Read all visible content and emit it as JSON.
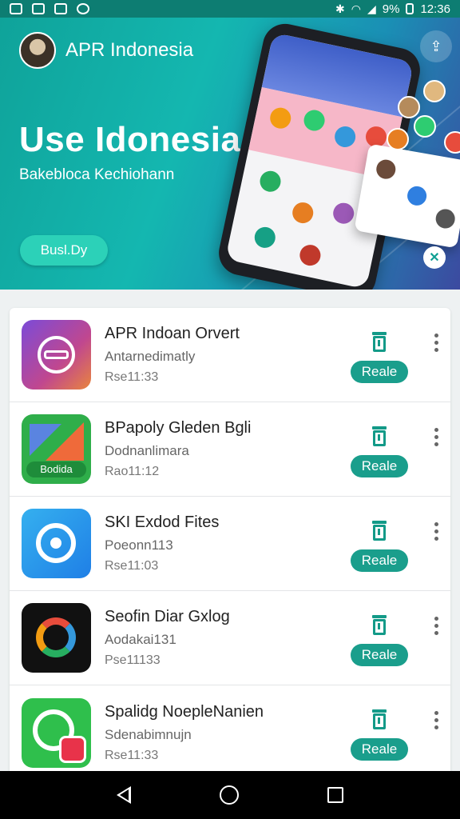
{
  "status_bar": {
    "time": "12:36",
    "battery": "9%"
  },
  "hero": {
    "brand_name": "APR Indonesia",
    "title": "Use Idonesia",
    "subtitle": "Bakebloca Kechiohann",
    "cta_label": "Busl.Dy"
  },
  "apps": [
    {
      "name": "APR Indoan Orvert",
      "subtitle": "Antarnedimatly",
      "meta": "Rse11:33",
      "action_label": "Reale",
      "icon": "globe-app-icon"
    },
    {
      "name": "BPapoly Gleden Bgli",
      "subtitle": "Dodnanlimara",
      "meta": "Rao11:12",
      "action_label": "Reale",
      "icon": "kite-app-icon"
    },
    {
      "name": "SKI Exdod Fites",
      "subtitle": "Poeonn113",
      "meta": "Rse11:03",
      "action_label": "Reale",
      "icon": "chat-bubble-app-icon"
    },
    {
      "name": "Seofin Diar Gxlog",
      "subtitle": "Aodakai131",
      "meta": "Pse11133",
      "action_label": "Reale",
      "icon": "arrows-app-icon"
    },
    {
      "name": "Spalidg NoepleNanien",
      "subtitle": "Sdenabimnujn",
      "meta": "Rse11:33",
      "action_label": "Reale",
      "icon": "phone-app-icon"
    }
  ],
  "colors": {
    "accent": "#1a9e8c",
    "hero_start": "#0fa39a",
    "hero_end": "#3c4aa0"
  }
}
